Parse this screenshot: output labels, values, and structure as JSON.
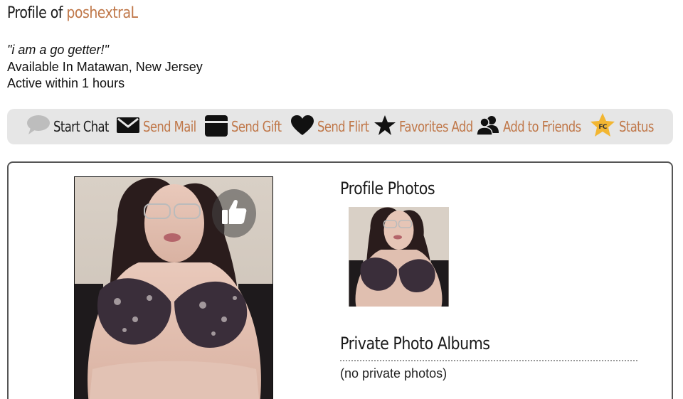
{
  "header": {
    "title_prefix": "Profile of",
    "username": "poshextraL"
  },
  "profile": {
    "tagline": "\"i am a go getter!\"",
    "location": "Available In Matawan, New Jersey",
    "activity": "Active within 1 hours"
  },
  "actions": {
    "start_chat": "Start Chat",
    "send_mail": "Send Mail",
    "send_gift": "Send Gift",
    "send_flirt": "Send Flirt",
    "favorites_add": "Favorites Add",
    "add_to_friends": "Add to Friends",
    "status": "Status",
    "status_badge": "FC"
  },
  "sections": {
    "profile_photos": "Profile Photos",
    "private_photo_albums": "Private Photo Albums",
    "no_private_photos": "(no private photos)"
  },
  "colors": {
    "link": "#c0784a",
    "action_bar_bg": "#e6e6e6",
    "text": "#111111"
  }
}
